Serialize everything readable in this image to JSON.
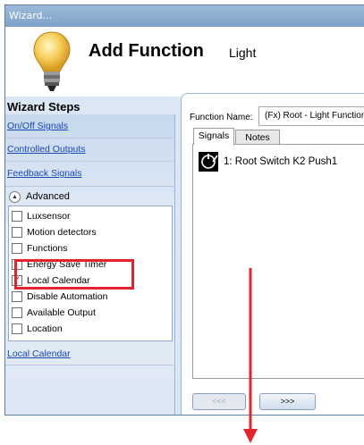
{
  "window": {
    "title": "Wizard..."
  },
  "header": {
    "title": "Add Function",
    "subtitle": "Light",
    "icon": "lightbulb-icon"
  },
  "steps": {
    "title": "Wizard Steps",
    "links": [
      "On/Off Signals",
      "Controlled Outputs",
      "Feedback Signals"
    ],
    "advanced_label": "Advanced",
    "advanced_items": [
      {
        "label": "Luxsensor",
        "checked": false
      },
      {
        "label": "Motion detectors",
        "checked": false
      },
      {
        "label": "Functions",
        "checked": false
      },
      {
        "label": "Energy Save Timer",
        "checked": false
      },
      {
        "label": "Local Calendar",
        "checked": true
      },
      {
        "label": "Disable Automation",
        "checked": false
      },
      {
        "label": "Available Output",
        "checked": false
      },
      {
        "label": "Location",
        "checked": false
      }
    ],
    "extra_link": "Local Calendar"
  },
  "main": {
    "function_name_label": "Function Name:",
    "function_name_value": "(Fx) Root - Light Function",
    "tabs": [
      "Signals",
      "Notes"
    ],
    "active_tab": "Signals",
    "signals": [
      {
        "label": "1: Root Switch K2 Push1",
        "icon": "switch-icon"
      }
    ],
    "back_button": "<<<",
    "next_button": ">>>"
  },
  "annotations": {
    "highlight_color": "#e5232d",
    "arrow_color": "#e5232d"
  }
}
